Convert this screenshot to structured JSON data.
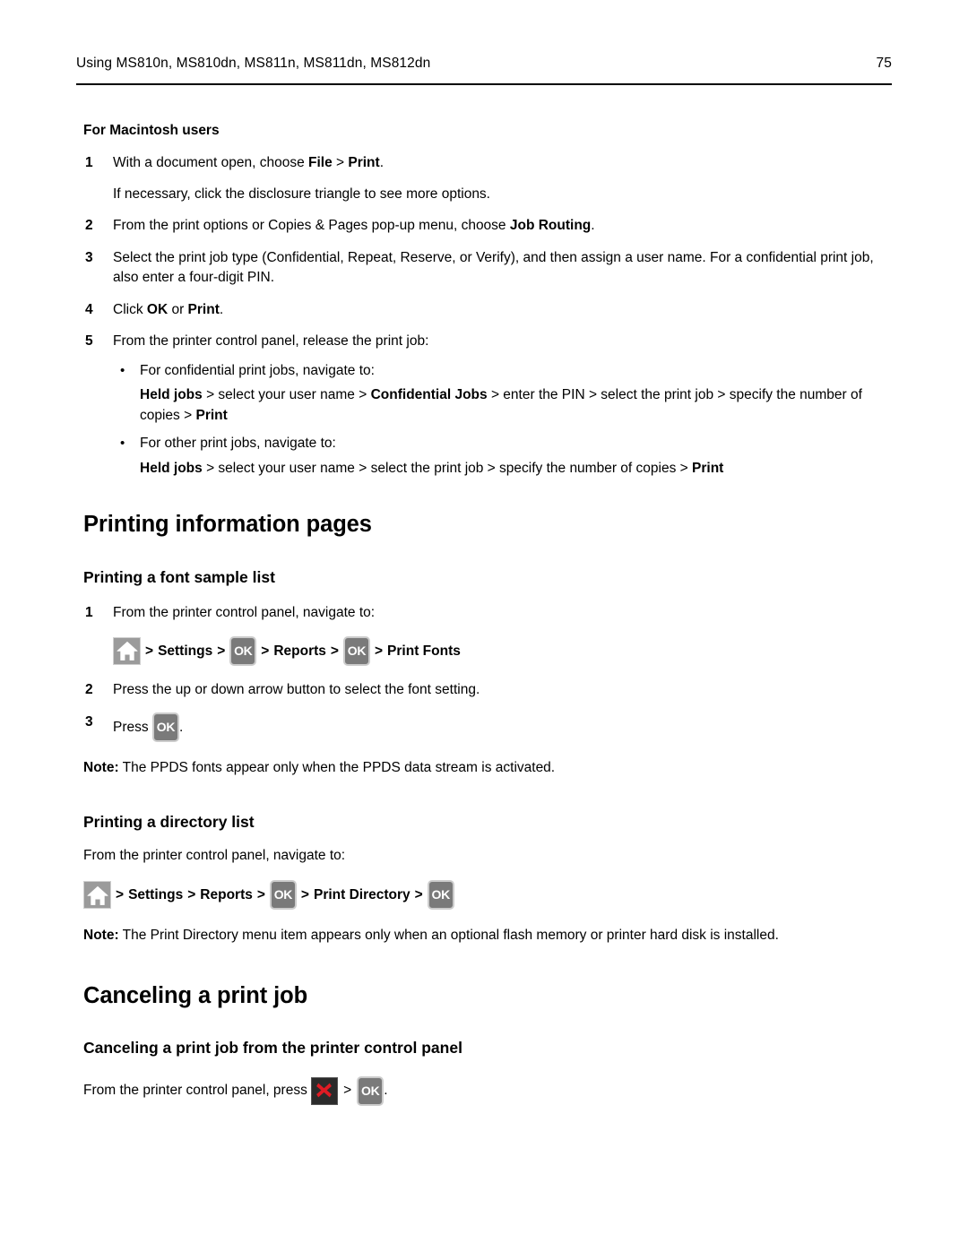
{
  "header": {
    "title": "Using MS810n, MS810dn, MS811n, MS811dn, MS812dn",
    "page_number": "75"
  },
  "macintosh_section": {
    "subhead": "For Macintosh users",
    "steps": [
      {
        "num": "1",
        "text_parts": [
          {
            "t": "With a document open, choose ",
            "bold": false
          },
          {
            "t": "File",
            "bold": true
          },
          {
            "t": " > ",
            "bold": false
          },
          {
            "t": "Print",
            "bold": true
          },
          {
            "t": ".",
            "bold": false
          }
        ],
        "sub_para": "If necessary, click the disclosure triangle to see more options."
      },
      {
        "num": "2",
        "text_parts": [
          {
            "t": "From the print options or Copies & Pages pop-up menu, choose ",
            "bold": false
          },
          {
            "t": "Job Routing",
            "bold": true
          },
          {
            "t": ".",
            "bold": false
          }
        ]
      },
      {
        "num": "3",
        "text_parts": [
          {
            "t": "Select the print job type (Confidential, Repeat, Reserve, or Verify), and then assign a user name. For a confidential print job, also enter a four-digit PIN.",
            "bold": false
          }
        ]
      },
      {
        "num": "4",
        "text_parts": [
          {
            "t": "Click ",
            "bold": false
          },
          {
            "t": "OK",
            "bold": true
          },
          {
            "t": " or ",
            "bold": false
          },
          {
            "t": "Print",
            "bold": true
          },
          {
            "t": ".",
            "bold": false
          }
        ]
      },
      {
        "num": "5",
        "text_parts": [
          {
            "t": "From the printer control panel, release the print job:",
            "bold": false
          }
        ]
      }
    ],
    "bullets": [
      {
        "lead": "For confidential print jobs, navigate to:",
        "nav_parts": [
          {
            "t": "Held jobs",
            "bold": true
          },
          {
            "t": " > select your user name > ",
            "bold": false
          },
          {
            "t": "Confidential Jobs",
            "bold": true
          },
          {
            "t": " > enter the PIN > select the print job > specify the number of copies > ",
            "bold": false
          },
          {
            "t": "Print",
            "bold": true
          }
        ]
      },
      {
        "lead": "For other print jobs, navigate to:",
        "nav_parts": [
          {
            "t": "Held jobs",
            "bold": true
          },
          {
            "t": " > select your user name > select the print job > specify the number of copies > ",
            "bold": false
          },
          {
            "t": "Print",
            "bold": true
          }
        ]
      }
    ]
  },
  "printing_info": {
    "chapter_title": "Printing information pages",
    "font_sample": {
      "section_title": "Printing a font sample list",
      "step1_num": "1",
      "step1_text": "From the printer control panel, navigate to:",
      "nav_chain": [
        {
          "kind": "icon",
          "icon": "home-icon"
        },
        {
          "kind": "sep",
          "label": ">"
        },
        {
          "kind": "word",
          "label": "Settings"
        },
        {
          "kind": "sep",
          "label": ">"
        },
        {
          "kind": "icon",
          "icon": "ok-button-icon",
          "label": "OK"
        },
        {
          "kind": "sep",
          "label": ">"
        },
        {
          "kind": "word",
          "label": "Reports"
        },
        {
          "kind": "sep",
          "label": ">"
        },
        {
          "kind": "icon",
          "icon": "ok-button-icon",
          "label": "OK"
        },
        {
          "kind": "sep",
          "label": ">"
        },
        {
          "kind": "word",
          "label": "Print Fonts"
        }
      ],
      "step2_num": "2",
      "step2_text": "Press the up or down arrow button to select the font setting.",
      "step3_num": "3",
      "step3_prefix": "Press",
      "step3_key_label": "OK",
      "step3_suffix": ".",
      "note_label": "Note:",
      "note_text": " The PPDS fonts appear only when the PPDS data stream is activated."
    },
    "directory_list": {
      "section_title": "Printing a directory list",
      "intro": "From the printer control panel, navigate to:",
      "nav_chain": [
        {
          "kind": "icon",
          "icon": "home-icon"
        },
        {
          "kind": "sep",
          "label": ">"
        },
        {
          "kind": "word",
          "label": "Settings"
        },
        {
          "kind": "sep",
          "label": ">"
        },
        {
          "kind": "word",
          "label": "Reports"
        },
        {
          "kind": "sep",
          "label": ">"
        },
        {
          "kind": "icon",
          "icon": "ok-button-icon",
          "label": "OK"
        },
        {
          "kind": "sep",
          "label": ">"
        },
        {
          "kind": "word",
          "label": "Print Directory"
        },
        {
          "kind": "sep",
          "label": ">"
        },
        {
          "kind": "icon",
          "icon": "ok-button-icon",
          "label": "OK"
        }
      ],
      "note_label": "Note:",
      "note_text": " The Print Directory menu item appears only when an optional flash memory or printer hard disk is installed."
    }
  },
  "canceling": {
    "chapter_title": "Canceling a print job",
    "section_title": "Canceling a print job from the printer control panel",
    "line_prefix": "From the printer control panel, press",
    "cancel_key": "cancel-icon",
    "separator": ">",
    "ok_key_label": "OK",
    "line_suffix": "."
  },
  "colors": {
    "home_key_fill": "#9b9b9b",
    "home_key_border": "#cfcfcf",
    "ok_key_fill": "#7a7a7a",
    "ok_key_border": "#cccccc",
    "cancel_key_fill": "#2b2b2b",
    "cancel_x": "#e01b24",
    "text": "#000000"
  }
}
